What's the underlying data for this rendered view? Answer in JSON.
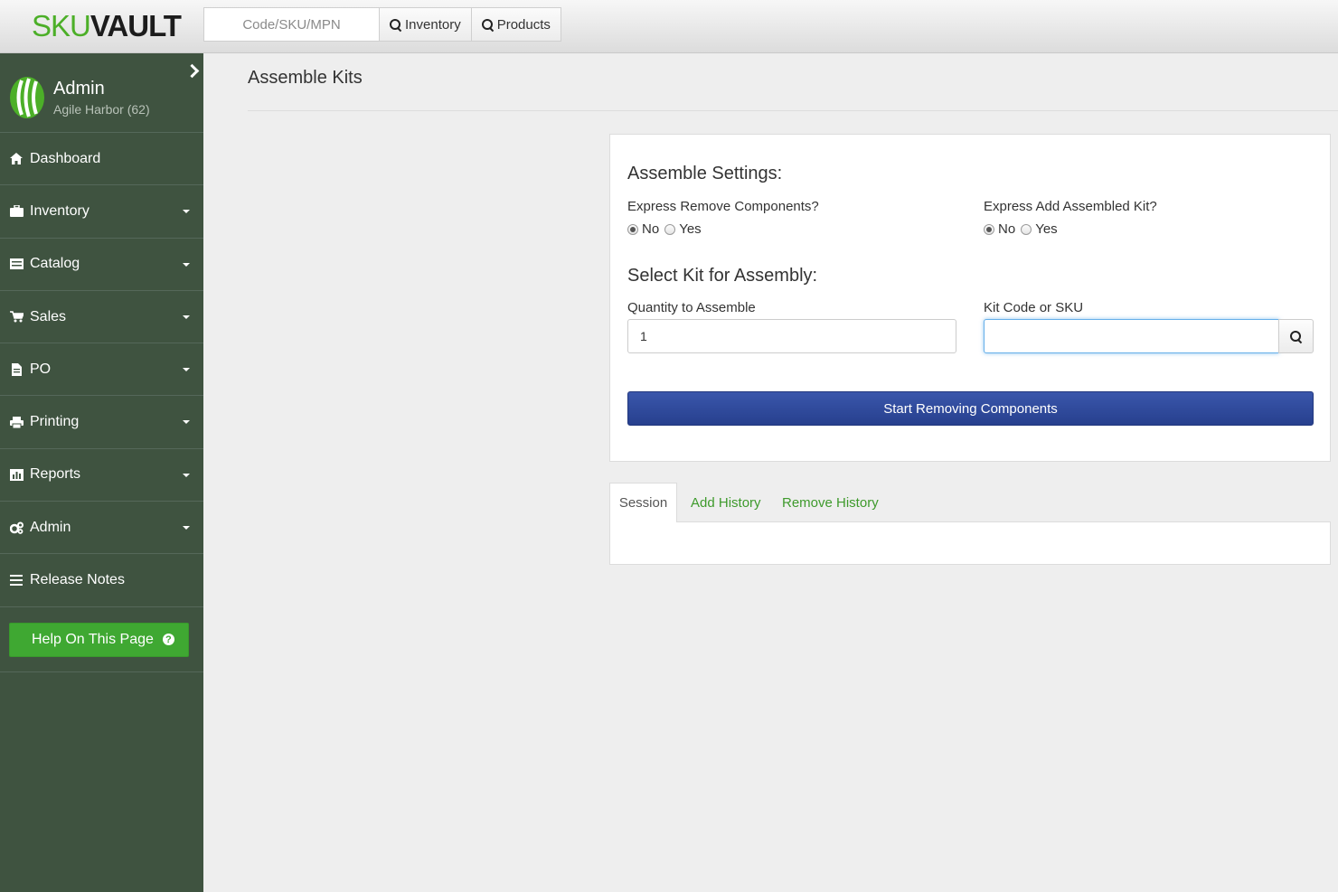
{
  "header": {
    "logo_sku": "SKU",
    "logo_vault": "VAULT",
    "search_placeholder": "Code/SKU/MPN",
    "inventory_btn": "Inventory",
    "products_btn": "Products"
  },
  "sidebar": {
    "user_name": "Admin",
    "user_org": "Agile Harbor (62)",
    "items": [
      {
        "label": "Dashboard",
        "icon": "home-icon"
      },
      {
        "label": "Inventory",
        "icon": "briefcase-icon"
      },
      {
        "label": "Catalog",
        "icon": "list-icon"
      },
      {
        "label": "Sales",
        "icon": "cart-icon"
      },
      {
        "label": "PO",
        "icon": "document-icon"
      },
      {
        "label": "Printing",
        "icon": "printer-icon"
      },
      {
        "label": "Reports",
        "icon": "chart-icon"
      },
      {
        "label": "Admin",
        "icon": "cogs-icon"
      },
      {
        "label": "Release Notes",
        "icon": "menu-icon"
      }
    ],
    "help_label": "Help On This Page",
    "help_icon_char": "?"
  },
  "page": {
    "title": "Assemble Kits"
  },
  "settings": {
    "heading": "Assemble Settings:",
    "express_remove_label": "Express Remove Components?",
    "express_add_label": "Express Add Assembled Kit?",
    "no_label": "No",
    "yes_label": "Yes",
    "express_remove_value": "No",
    "express_add_value": "No"
  },
  "assembly": {
    "heading": "Select Kit for Assembly:",
    "quantity_label": "Quantity to Assemble",
    "quantity_value": "1",
    "kit_label": "Kit Code or SKU",
    "kit_value": "",
    "start_button": "Start Removing Components"
  },
  "tabs": {
    "session": "Session",
    "add_history": "Add History",
    "remove_history": "Remove History"
  },
  "colors": {
    "sidebar_bg": "#3f5340",
    "brand_green": "#4caf28",
    "primary_blue": "#2f4a9e",
    "help_green": "#3fa832"
  }
}
